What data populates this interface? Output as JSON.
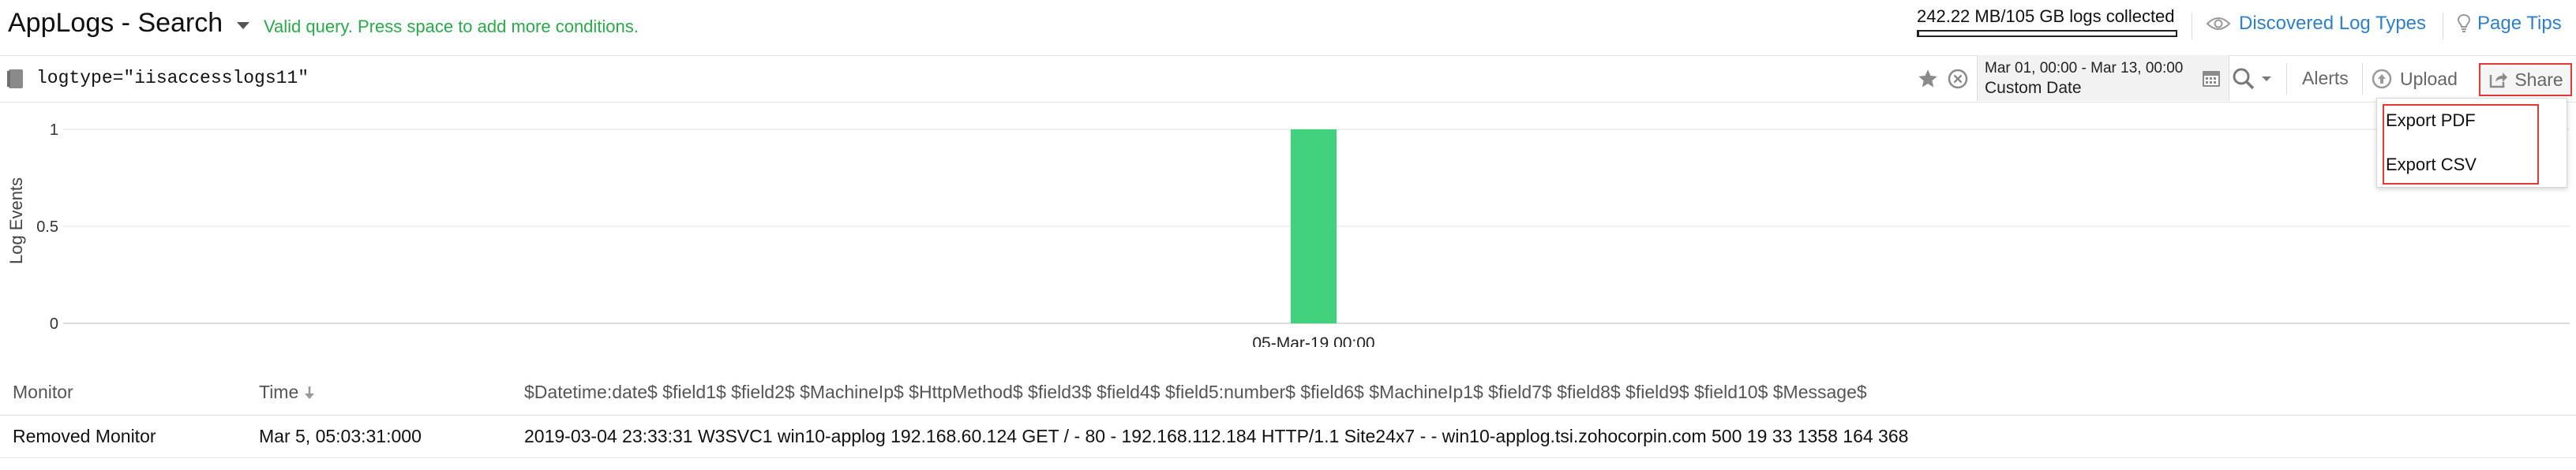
{
  "header": {
    "title": "AppLogs - Search",
    "query_status": "Valid query. Press space to add more conditions.",
    "usage_text": "242.22 MB/105 GB logs collected",
    "usage_fraction": 0.0023,
    "discovered_link": "Discovered Log Types",
    "page_tips_link": "Page Tips"
  },
  "query_bar": {
    "query": "logtype=\"iisaccesslogs11\"",
    "date_range": "Mar 01, 00:00 - Mar 13, 00:00",
    "date_label": "Custom Date",
    "alerts_label": "Alerts",
    "upload_label": "Upload",
    "share_label": "Share"
  },
  "share_menu": {
    "items": [
      "Export PDF",
      "Export CSV"
    ]
  },
  "chart_data": {
    "type": "bar",
    "categories": [
      "05-Mar-19 00:00"
    ],
    "values": [
      1
    ],
    "ylabel": "Log Events",
    "yticks": [
      0,
      0.5,
      1
    ],
    "ylim": [
      0,
      1
    ],
    "grid": true,
    "bar_color": "#42d17d"
  },
  "table": {
    "columns": [
      "Monitor",
      "Time",
      "$Datetime:date$ $field1$ $field2$ $MachineIp$ $HttpMethod$ $field3$ $field4$ $field5:number$ $field6$ $MachineIp1$ $field7$ $field8$ $field9$ $field10$ $Message$"
    ],
    "rows": [
      [
        "Removed Monitor",
        "Mar 5, 05:03:31:000",
        "2019-03-04 23:33:31 W3SVC1 win10-applog 192.168.60.124 GET / - 80 - 192.168.112.184 HTTP/1.1 Site24x7 - - win10-applog.tsi.zohocorpin.com 500 19 33 1358 164 368"
      ]
    ]
  },
  "colors": {
    "accent": "#2f80c8",
    "status": "#2aa84a",
    "highlight": "#e53935"
  }
}
